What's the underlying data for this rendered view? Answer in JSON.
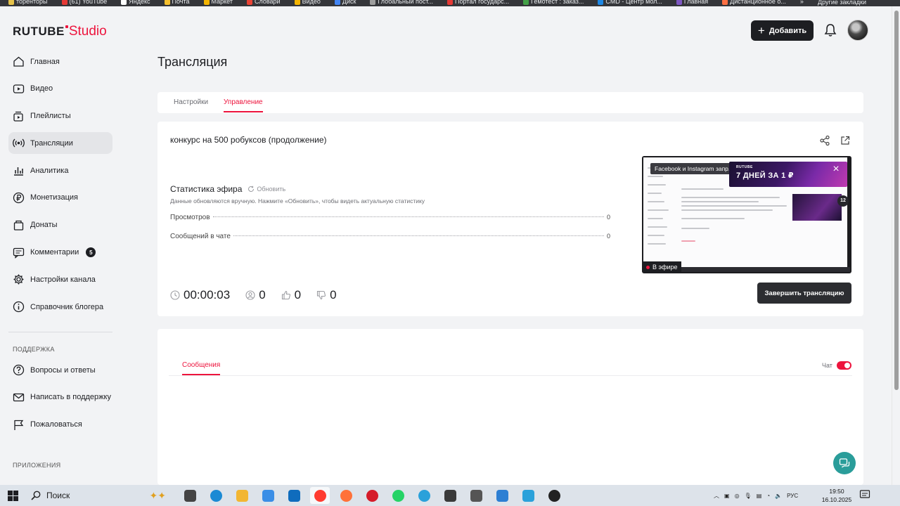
{
  "bookmarks": [
    {
      "label": "торенторы",
      "color": "#e6c24a"
    },
    {
      "label": "(61) YouTube",
      "color": "#e53935"
    },
    {
      "label": "Яндекс",
      "color": "#ffffff"
    },
    {
      "label": "Почта",
      "color": "#f7c02d"
    },
    {
      "label": "Маркет",
      "color": "#f4b400"
    },
    {
      "label": "Словари",
      "color": "#ea4335"
    },
    {
      "label": "Видео",
      "color": "#f4b400"
    },
    {
      "label": "Диск",
      "color": "#4285f4"
    },
    {
      "label": "Глобальный пост...",
      "color": "#9e9e9e"
    },
    {
      "label": "Портал государс...",
      "color": "#e53935"
    },
    {
      "label": "Гемотест : заказ...",
      "color": "#43a047"
    },
    {
      "label": "CMD - Центр мол...",
      "color": "#1e88e5"
    },
    {
      "label": "Главная",
      "color": "#7e57c2"
    },
    {
      "label": "Дистанционное о...",
      "color": "#ff7043"
    }
  ],
  "bookmarks_more": "»",
  "bookmarks_other": "Другие закладки",
  "header": {
    "logo_main": "RUTUBE",
    "logo_studio": "Studio",
    "add_label": "Добавить"
  },
  "nav": [
    {
      "label": "Главная",
      "icon": "home-icon",
      "active": false
    },
    {
      "label": "Видео",
      "icon": "video-icon",
      "active": false
    },
    {
      "label": "Плейлисты",
      "icon": "playlist-icon",
      "active": false
    },
    {
      "label": "Трансляции",
      "icon": "broadcast-icon",
      "active": true
    },
    {
      "label": "Аналитика",
      "icon": "analytics-icon",
      "active": false
    },
    {
      "label": "Монетизация",
      "icon": "ruble-icon",
      "active": false
    },
    {
      "label": "Донаты",
      "icon": "donate-icon",
      "active": false
    },
    {
      "label": "Комментарии",
      "icon": "comment-icon",
      "active": false,
      "badge": "5"
    },
    {
      "label": "Настройки канала",
      "icon": "gear-icon",
      "active": false
    },
    {
      "label": "Справочник блогера",
      "icon": "info-icon",
      "active": false
    }
  ],
  "support": {
    "title": "ПОДДЕРЖКА",
    "items": [
      {
        "label": "Вопросы и ответы",
        "icon": "question-icon"
      },
      {
        "label": "Написать в поддержку",
        "icon": "mail-icon"
      },
      {
        "label": "Пожаловаться",
        "icon": "flag-icon"
      }
    ]
  },
  "apps_title": "ПРИЛОЖЕНИЯ",
  "page": {
    "title": "Трансляция",
    "tabs": [
      "Настройки",
      "Управление"
    ],
    "active_tab": "Управление"
  },
  "stream": {
    "title": "конкурс на 500 робуксов (продолжение)",
    "stats_title": "Статистика эфира",
    "refresh_label": "Обновить",
    "stats_note": "Данные обновляются вручную. Нажмите «Обновить», чтобы видеть актуальную статистику",
    "stats": [
      {
        "label": "Просмотров",
        "value": "0"
      },
      {
        "label": "Сообщений в чате",
        "value": "0"
      }
    ],
    "duration": "00:00:03",
    "viewers": "0",
    "likes": "0",
    "dislikes": "0",
    "end_label": "Завершить трансляцию",
    "preview": {
      "instagram_text": "Facebook и Instagram запр...",
      "ad_brand": "RUTUBE",
      "ad_text": "7 ДНЕЙ ЗА 1 ₽",
      "side_number": "12",
      "live_label": "В эфире"
    }
  },
  "messages": {
    "tab_label": "Сообщения",
    "chat_label": "Чат",
    "chat_enabled": true
  },
  "taskbar": {
    "search_label": "Поиск",
    "lang": "РУС",
    "time": "19:50",
    "date": "16.10.2025",
    "apps": [
      {
        "name": "task-view-icon",
        "color": "#444444"
      },
      {
        "name": "edge-icon",
        "color": "#1a8ad4"
      },
      {
        "name": "explorer-icon",
        "color": "#f2b632"
      },
      {
        "name": "store-icon",
        "color": "#3a8ee6"
      },
      {
        "name": "outlook-icon",
        "color": "#0f6cbd"
      },
      {
        "name": "yandex-browser-icon",
        "color": "#ff3b30"
      },
      {
        "name": "firefox-icon",
        "color": "#ff7139"
      },
      {
        "name": "opera-icon",
        "color": "#d51c2a"
      },
      {
        "name": "whatsapp-icon",
        "color": "#25d366"
      },
      {
        "name": "telegram-icon",
        "color": "#2aa1da"
      },
      {
        "name": "clapper-icon",
        "color": "#3a3a3a"
      },
      {
        "name": "media-icon",
        "color": "#555555"
      },
      {
        "name": "vpn-icon",
        "color": "#2d7fd3"
      },
      {
        "name": "app-icon",
        "color": "#2aa1da"
      },
      {
        "name": "obs-icon",
        "color": "#222222"
      }
    ]
  },
  "colors": {
    "accent": "#ed143d",
    "dark_button": "#1d1e22",
    "help_button": "#2a9d9a"
  }
}
